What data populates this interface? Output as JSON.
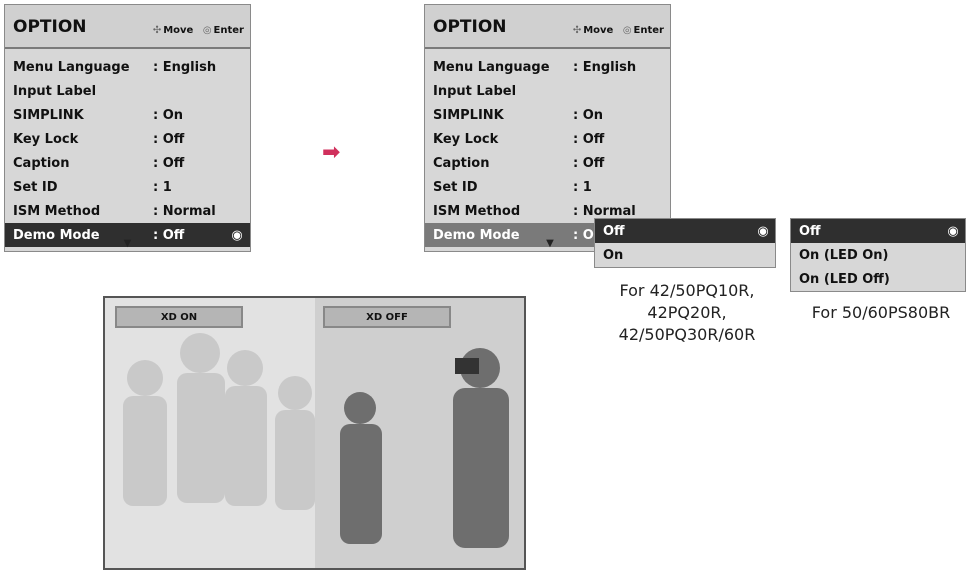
{
  "menu": {
    "title": "OPTION",
    "hint_move": "Move",
    "hint_enter": "Enter",
    "items": [
      {
        "label": "Menu Language",
        "value": ": English"
      },
      {
        "label": "Input Label",
        "value": ""
      },
      {
        "label": "SIMPLINK",
        "value": ": On"
      },
      {
        "label": "Key Lock",
        "value": ": Off"
      },
      {
        "label": "Caption",
        "value": ": Off"
      },
      {
        "label": "Set ID",
        "value": ": 1"
      },
      {
        "label": "ISM Method",
        "value": ": Normal"
      },
      {
        "label": "Demo Mode",
        "value": ": Off"
      }
    ],
    "demo_value_partial": ": Of"
  },
  "popup1": {
    "options": [
      "Off",
      "On"
    ]
  },
  "popup2": {
    "options": [
      "Off",
      "On (LED On)",
      "On (LED Off)"
    ]
  },
  "captions": {
    "model1_line1": "For 42/50PQ10R,",
    "model1_line2": "42PQ20R,",
    "model1_line3": "42/50PQ30R/60R",
    "model2": "For 50/60PS80BR"
  },
  "photo": {
    "label_on": "XD ON",
    "label_off": "XD OFF"
  },
  "colors": {
    "arrow": "#d0305c",
    "selected_row": "#2f2f2f",
    "menu_bg": "#d7d7d7"
  },
  "icons": {
    "move": "four-way-arrow-icon",
    "enter": "circle-dot-icon",
    "selected": "radio-selected-icon",
    "more": "triangle-down-icon"
  }
}
